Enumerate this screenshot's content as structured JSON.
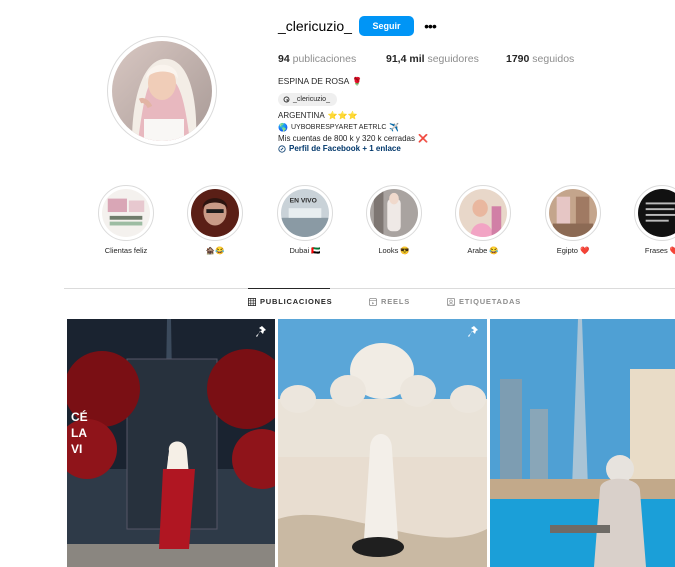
{
  "profile": {
    "username": "_clericuzio_",
    "follow_label": "Seguir",
    "more_label": "•••"
  },
  "stats": {
    "posts_count": "94",
    "posts_label": "publicaciones",
    "followers_count": "91,4 mil",
    "followers_label": "seguidores",
    "following_count": "1790",
    "following_label": "seguidos"
  },
  "bio": {
    "name": "ESPINA DE ROSA",
    "threads_handle": "_clericuzio_",
    "country": "ARGENTINA",
    "line_brand": "UYBOBRESPYARET AETRLC",
    "line_accounts": "Mis cuentas de 800 k y 320 k cerradas",
    "link_text": "Perfil de Facebook + 1 enlace"
  },
  "highlights": [
    {
      "label": "Clientas feliz",
      "emoji": ""
    },
    {
      "label": "",
      "emoji": "🏚️😂"
    },
    {
      "label": "Dubai",
      "emoji": "🇦🇪"
    },
    {
      "label": "Looks",
      "emoji": "😎"
    },
    {
      "label": "Arabe",
      "emoji": "😂"
    },
    {
      "label": "Egipto",
      "emoji": "❤️"
    },
    {
      "label": "Frases",
      "emoji": "❤️"
    }
  ],
  "highlight_overlays": {
    "dubai_text": "EN VIVO"
  },
  "tabs": [
    {
      "label": "PUBLICACIONES",
      "icon": "grid-icon"
    },
    {
      "label": "REELS",
      "icon": "reels-icon"
    },
    {
      "label": "ETIQUETADAS",
      "icon": "tagged-icon"
    }
  ],
  "posts": [
    {
      "pinned": true,
      "overlay_text": [
        "CÉ",
        "LA",
        "VI"
      ]
    },
    {
      "pinned": true
    },
    {
      "pinned": false
    }
  ],
  "colors": {
    "accent": "#0095f6",
    "link": "#00376b",
    "muted": "#8e8e8e",
    "border": "#dbdbdb"
  }
}
